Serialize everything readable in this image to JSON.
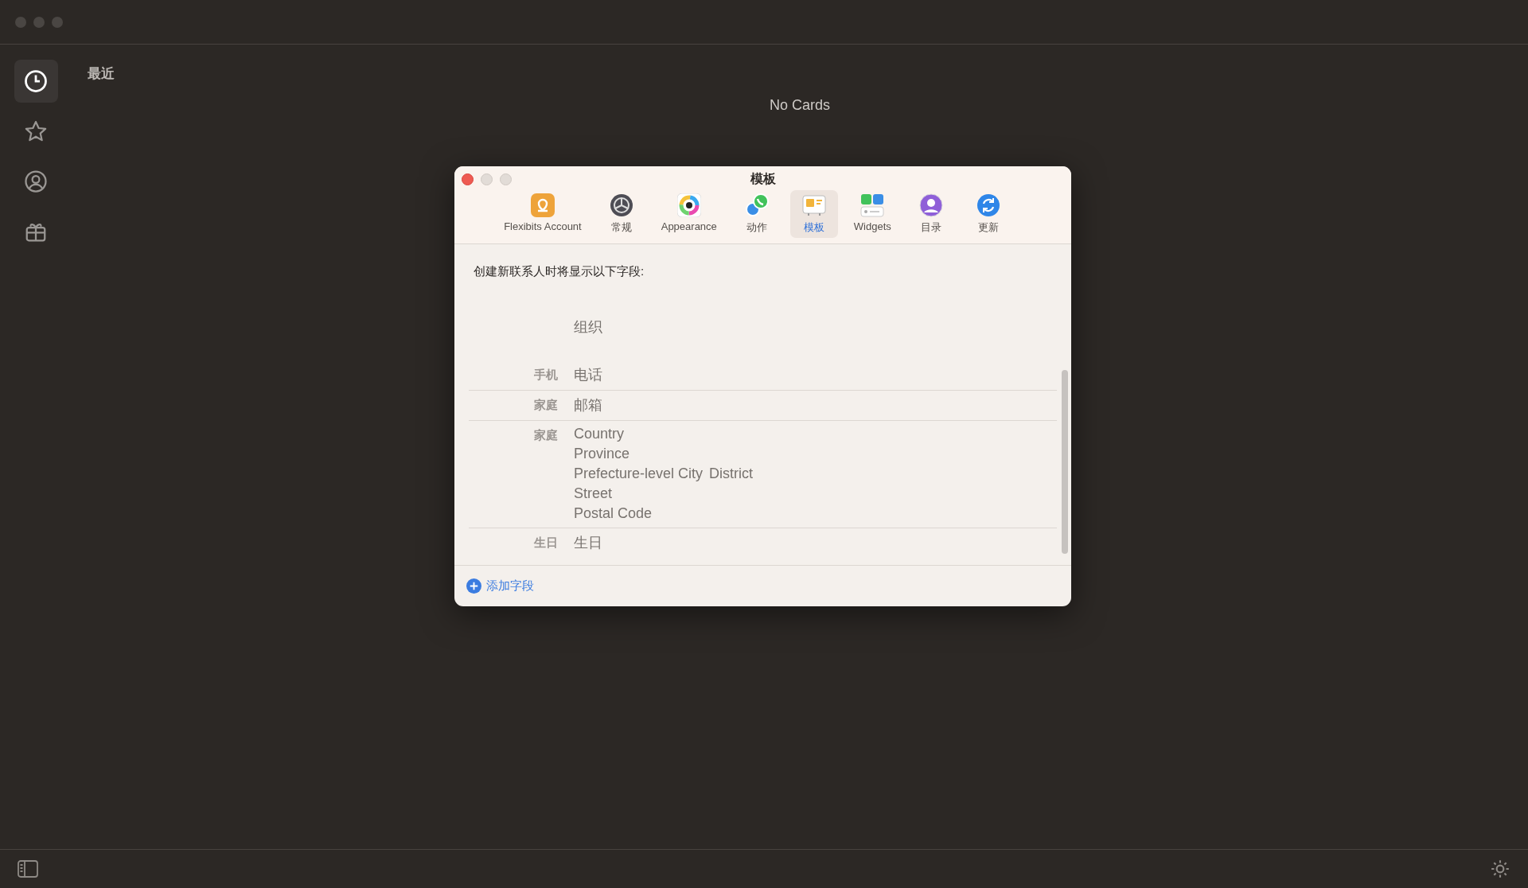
{
  "sidebar": {
    "items": [
      {
        "selected": true
      },
      {
        "selected": false
      },
      {
        "selected": false
      },
      {
        "selected": false
      }
    ]
  },
  "section_title": "最近",
  "empty_message": "No Cards",
  "dialog": {
    "title": "模板",
    "tabs": [
      {
        "label": "Flexibits Account",
        "selected": false
      },
      {
        "label": "常规",
        "selected": false
      },
      {
        "label": "Appearance",
        "selected": false
      },
      {
        "label": "动作",
        "selected": false
      },
      {
        "label": "模板",
        "selected": true
      },
      {
        "label": "Widgets",
        "selected": false
      },
      {
        "label": "目录",
        "selected": false
      },
      {
        "label": "更新",
        "selected": false
      }
    ],
    "description": "创建新联系人时将显示以下字段:",
    "fields": [
      {
        "lines": [
          [
            "组织"
          ]
        ]
      },
      {
        "label": "手机",
        "lines": [
          [
            "电话"
          ]
        ]
      },
      {
        "label": "家庭",
        "lines": [
          [
            "邮箱"
          ]
        ]
      },
      {
        "label": "家庭",
        "lines": [
          [
            "Country"
          ],
          [
            "Province"
          ],
          [
            "Prefecture-level City",
            "District"
          ],
          [
            "Street"
          ],
          [
            "Postal Code"
          ]
        ]
      },
      {
        "label": "生日",
        "lines": [
          [
            "生日"
          ]
        ]
      }
    ],
    "add_button": "添加字段"
  }
}
